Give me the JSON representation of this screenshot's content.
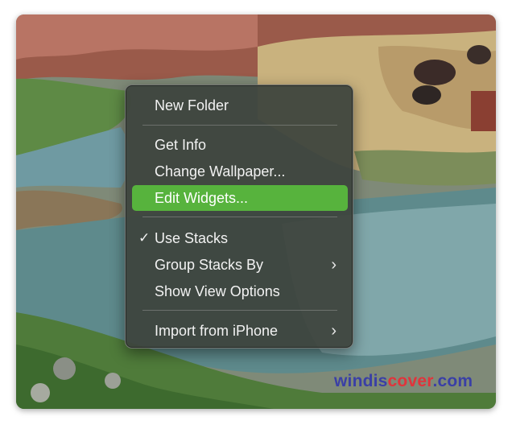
{
  "menu": {
    "new_folder": "New Folder",
    "get_info": "Get Info",
    "change_wallpaper": "Change Wallpaper...",
    "edit_widgets": "Edit Widgets...",
    "use_stacks": "Use Stacks",
    "use_stacks_check": "✓",
    "group_stacks_by": "Group Stacks By",
    "show_view_options": "Show View Options",
    "import_from_iphone": "Import from iPhone",
    "submenu_chevron": "›",
    "highlight_color": "#57b33d"
  },
  "watermark": {
    "part1": "windis",
    "part2": "cover",
    "part3": ".com"
  }
}
